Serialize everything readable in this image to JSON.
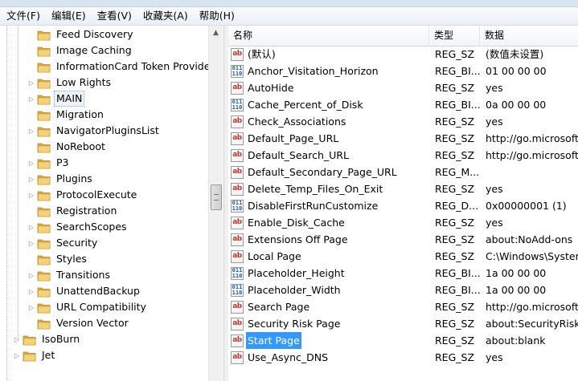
{
  "menu": [
    {
      "label": "文件(F)"
    },
    {
      "label": "编辑(E)"
    },
    {
      "label": "查看(V)"
    },
    {
      "label": "收藏夹(A)"
    },
    {
      "label": "帮助(H)"
    }
  ],
  "tree": {
    "items": [
      {
        "label": "Feed Discovery",
        "expandable": false,
        "level": 2
      },
      {
        "label": "Image Caching",
        "expandable": false,
        "level": 2
      },
      {
        "label": "InformationCard Token Provider",
        "expandable": false,
        "level": 2
      },
      {
        "label": "Low Rights",
        "expandable": true,
        "level": 2
      },
      {
        "label": "MAIN",
        "expandable": true,
        "level": 2,
        "selected": true
      },
      {
        "label": "Migration",
        "expandable": false,
        "level": 2
      },
      {
        "label": "NavigatorPluginsList",
        "expandable": true,
        "level": 2
      },
      {
        "label": "NoReboot",
        "expandable": false,
        "level": 2
      },
      {
        "label": "P3",
        "expandable": true,
        "level": 2
      },
      {
        "label": "Plugins",
        "expandable": true,
        "level": 2
      },
      {
        "label": "ProtocolExecute",
        "expandable": true,
        "level": 2
      },
      {
        "label": "Registration",
        "expandable": false,
        "level": 2
      },
      {
        "label": "SearchScopes",
        "expandable": true,
        "level": 2
      },
      {
        "label": "Security",
        "expandable": true,
        "level": 2
      },
      {
        "label": "Styles",
        "expandable": false,
        "level": 2
      },
      {
        "label": "Transitions",
        "expandable": true,
        "level": 2
      },
      {
        "label": "UnattendBackup",
        "expandable": true,
        "level": 2
      },
      {
        "label": "URL Compatibility",
        "expandable": true,
        "level": 2
      },
      {
        "label": "Version Vector",
        "expandable": false,
        "level": 2
      },
      {
        "label": "IsoBurn",
        "expandable": true,
        "level": 1
      },
      {
        "label": "Jet",
        "expandable": true,
        "level": 1
      }
    ]
  },
  "values": {
    "headers": {
      "name": "名称",
      "type": "类型",
      "data": "数据"
    },
    "rows": [
      {
        "icon": "string-value-icon",
        "name": "(默认)",
        "type": "REG_SZ",
        "data": "(数值未设置)"
      },
      {
        "icon": "binary-value-icon",
        "name": "Anchor_Visitation_Horizon",
        "type": "REG_BI...",
        "data": "01 00 00 00"
      },
      {
        "icon": "string-value-icon",
        "name": "AutoHide",
        "type": "REG_SZ",
        "data": "yes"
      },
      {
        "icon": "binary-value-icon",
        "name": "Cache_Percent_of_Disk",
        "type": "REG_BI...",
        "data": "0a 00 00 00"
      },
      {
        "icon": "string-value-icon",
        "name": "Check_Associations",
        "type": "REG_SZ",
        "data": "yes"
      },
      {
        "icon": "string-value-icon",
        "name": "Default_Page_URL",
        "type": "REG_SZ",
        "data": "http://go.microsoft.c"
      },
      {
        "icon": "string-value-icon",
        "name": "Default_Search_URL",
        "type": "REG_SZ",
        "data": "http://go.microsoft.c"
      },
      {
        "icon": "string-value-icon",
        "name": "Default_Secondary_Page_URL",
        "type": "REG_M...",
        "data": ""
      },
      {
        "icon": "string-value-icon",
        "name": "Delete_Temp_Files_On_Exit",
        "type": "REG_SZ",
        "data": "yes"
      },
      {
        "icon": "binary-value-icon",
        "name": "DisableFirstRunCustomize",
        "type": "REG_D...",
        "data": "0x00000001 (1)"
      },
      {
        "icon": "string-value-icon",
        "name": "Enable_Disk_Cache",
        "type": "REG_SZ",
        "data": "yes"
      },
      {
        "icon": "string-value-icon",
        "name": "Extensions Off Page",
        "type": "REG_SZ",
        "data": "about:NoAdd-ons"
      },
      {
        "icon": "string-value-icon",
        "name": "Local Page",
        "type": "REG_SZ",
        "data": "C:\\Windows\\System"
      },
      {
        "icon": "binary-value-icon",
        "name": "Placeholder_Height",
        "type": "REG_BI...",
        "data": "1a 00 00 00"
      },
      {
        "icon": "binary-value-icon",
        "name": "Placeholder_Width",
        "type": "REG_BI...",
        "data": "1a 00 00 00"
      },
      {
        "icon": "string-value-icon",
        "name": "Search Page",
        "type": "REG_SZ",
        "data": "http://go.microsoft.c"
      },
      {
        "icon": "string-value-icon",
        "name": "Security Risk Page",
        "type": "REG_SZ",
        "data": "about:SecurityRisk"
      },
      {
        "icon": "string-value-icon",
        "name": "Start Page",
        "type": "REG_SZ",
        "data": "about:blank",
        "selected": true
      },
      {
        "icon": "string-value-icon",
        "name": "Use_Async_DNS",
        "type": "REG_SZ",
        "data": "yes"
      }
    ]
  },
  "icon_text": {
    "string": "ab",
    "binary_top": "011",
    "binary_bottom": "110"
  },
  "colors": {
    "selection": "#3399ff",
    "folder": "#e8c25c"
  }
}
